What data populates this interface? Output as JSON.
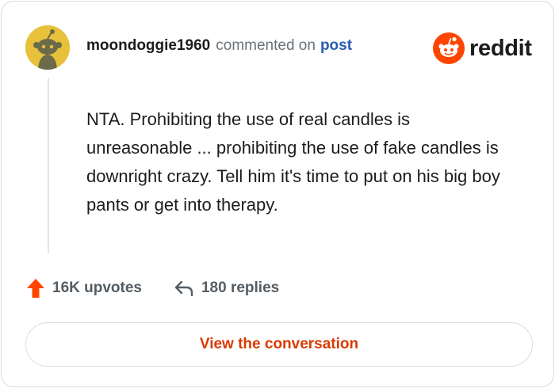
{
  "comment": {
    "username": "moondoggie1960",
    "action_text": "commented on",
    "post_link_label": "post",
    "avatar_icon": "snoo-avatar-icon",
    "body": "NTA. Prohibiting the use of real candles is unreasonable ... prohibiting the use of fake candles is downright crazy. Tell him it's time to put on his big boy pants or get into therapy."
  },
  "brand": {
    "name": "reddit",
    "icon": "reddit-snoo-icon",
    "color": "#ff4500"
  },
  "stats": {
    "upvotes_label": "16K upvotes",
    "upvote_icon": "upvote-arrow-icon",
    "upvote_color": "#ff4500",
    "replies_label": "180 replies",
    "reply_icon": "reply-arrow-icon"
  },
  "actions": {
    "view_conversation_label": "View the conversation",
    "accent_color": "#d93a00"
  }
}
